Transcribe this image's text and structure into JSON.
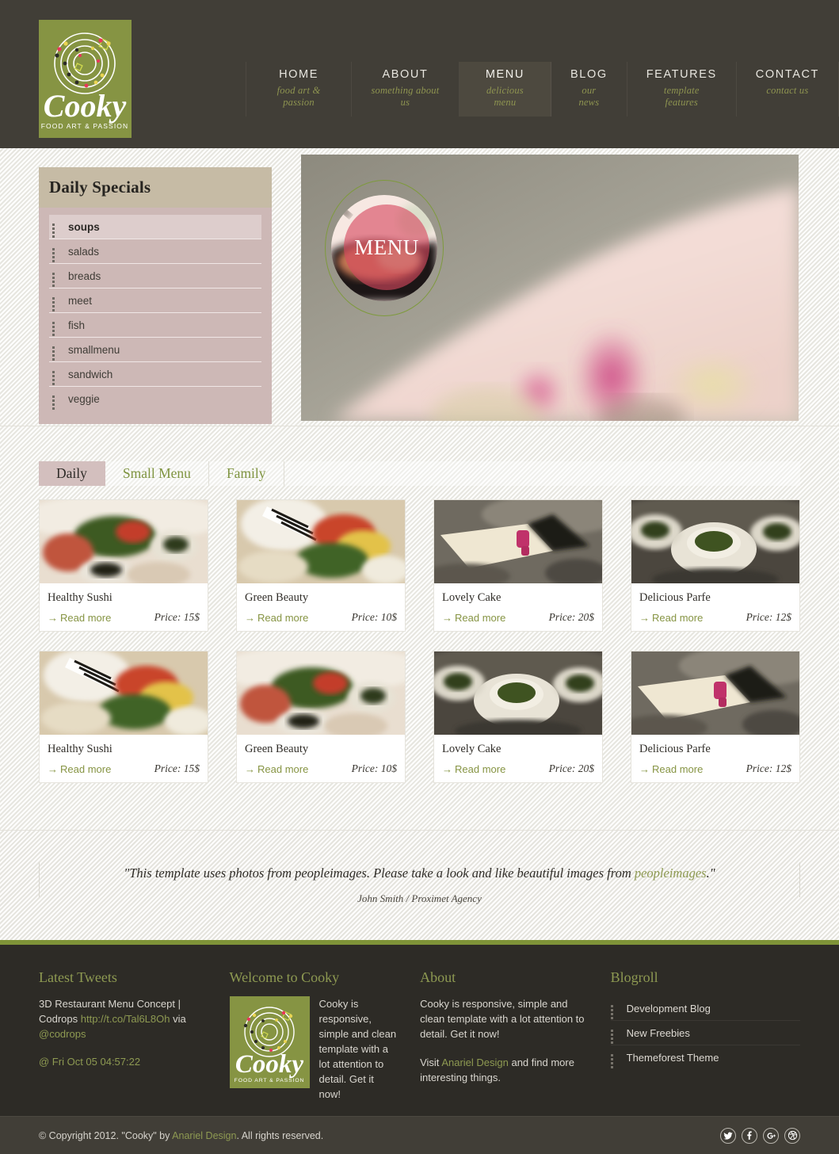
{
  "brand": {
    "name": "Cooky",
    "tagline": "FOOD ART & PASSION"
  },
  "nav": {
    "items": [
      {
        "label": "HOME",
        "sub": "food art & passion",
        "active": false
      },
      {
        "label": "ABOUT",
        "sub": "something about us",
        "active": false
      },
      {
        "label": "MENU",
        "sub": "delicious menu",
        "active": true
      },
      {
        "label": "BLOG",
        "sub": "our news",
        "active": false
      },
      {
        "label": "FEATURES",
        "sub": "template features",
        "active": false
      },
      {
        "label": "CONTACT",
        "sub": "contact us",
        "active": false
      }
    ]
  },
  "stripe": {
    "green": "#6e8b2a",
    "neutral": "#ccd3bd",
    "red": "#e14b5a"
  },
  "sidebar": {
    "title": "Daily Specials",
    "items": [
      {
        "label": "soups",
        "active": true
      },
      {
        "label": "salads",
        "active": false
      },
      {
        "label": "breads",
        "active": false
      },
      {
        "label": "meet",
        "active": false
      },
      {
        "label": "fish",
        "active": false
      },
      {
        "label": "smallmenu",
        "active": false
      },
      {
        "label": "sandwich",
        "active": false
      },
      {
        "label": "veggie",
        "active": false
      }
    ]
  },
  "hero": {
    "badge_label": "MENU"
  },
  "tabs": [
    {
      "label": "Daily",
      "active": true
    },
    {
      "label": "Small Menu",
      "active": false
    },
    {
      "label": "Family",
      "active": false
    }
  ],
  "cards": [
    {
      "title": "Healthy Sushi",
      "read_more": "Read more",
      "price": "Price: 15$"
    },
    {
      "title": "Green Beauty",
      "read_more": "Read more",
      "price": "Price: 10$"
    },
    {
      "title": "Lovely Cake",
      "read_more": "Read more",
      "price": "Price: 20$"
    },
    {
      "title": "Delicious Parfe",
      "read_more": "Read more",
      "price": "Price: 12$"
    },
    {
      "title": "Healthy Sushi",
      "read_more": "Read more",
      "price": "Price: 15$"
    },
    {
      "title": "Green Beauty",
      "read_more": "Read more",
      "price": "Price: 10$"
    },
    {
      "title": "Lovely Cake",
      "read_more": "Read more",
      "price": "Price: 20$"
    },
    {
      "title": "Delicious Parfe",
      "read_more": "Read more",
      "price": "Price: 12$"
    }
  ],
  "testimonial": {
    "quote_before": "\"This template uses photos from peopleimages. Please take a look and like beautiful images from ",
    "quote_link": "peopleimages",
    "quote_after": ".\"",
    "author": "John Smith / Proximet Agency"
  },
  "footer": {
    "tweets": {
      "heading": "Latest Tweets",
      "text_before": "3D Restaurant Menu Concept | Codrops ",
      "link": "http://t.co/Tal6L8Oh",
      "text_mid": " via ",
      "handle": "@codrops",
      "time": "@ Fri Oct 05 04:57:22"
    },
    "welcome": {
      "heading": "Welcome to Cooky",
      "text": "Cooky is responsive, simple and clean template with a lot attention to detail. Get it now!"
    },
    "about": {
      "heading": "About",
      "p1": "Cooky is responsive, simple and clean template with a lot attention to detail. Get it now!",
      "p2_before": "Visit ",
      "p2_link": "Anariel Design",
      "p2_after": " and find more interesting things."
    },
    "blogroll": {
      "heading": "Blogroll",
      "items": [
        {
          "label": "Development Blog"
        },
        {
          "label": "New Freebies"
        },
        {
          "label": "Themeforest Theme"
        }
      ]
    }
  },
  "copyright": {
    "before": "© Copyright 2012. \"Cooky\" by ",
    "link": "Anariel Design",
    "after": ". All rights reserved.",
    "socials": [
      "twitter-icon",
      "facebook-icon",
      "google-plus-icon",
      "dribbble-icon"
    ]
  }
}
